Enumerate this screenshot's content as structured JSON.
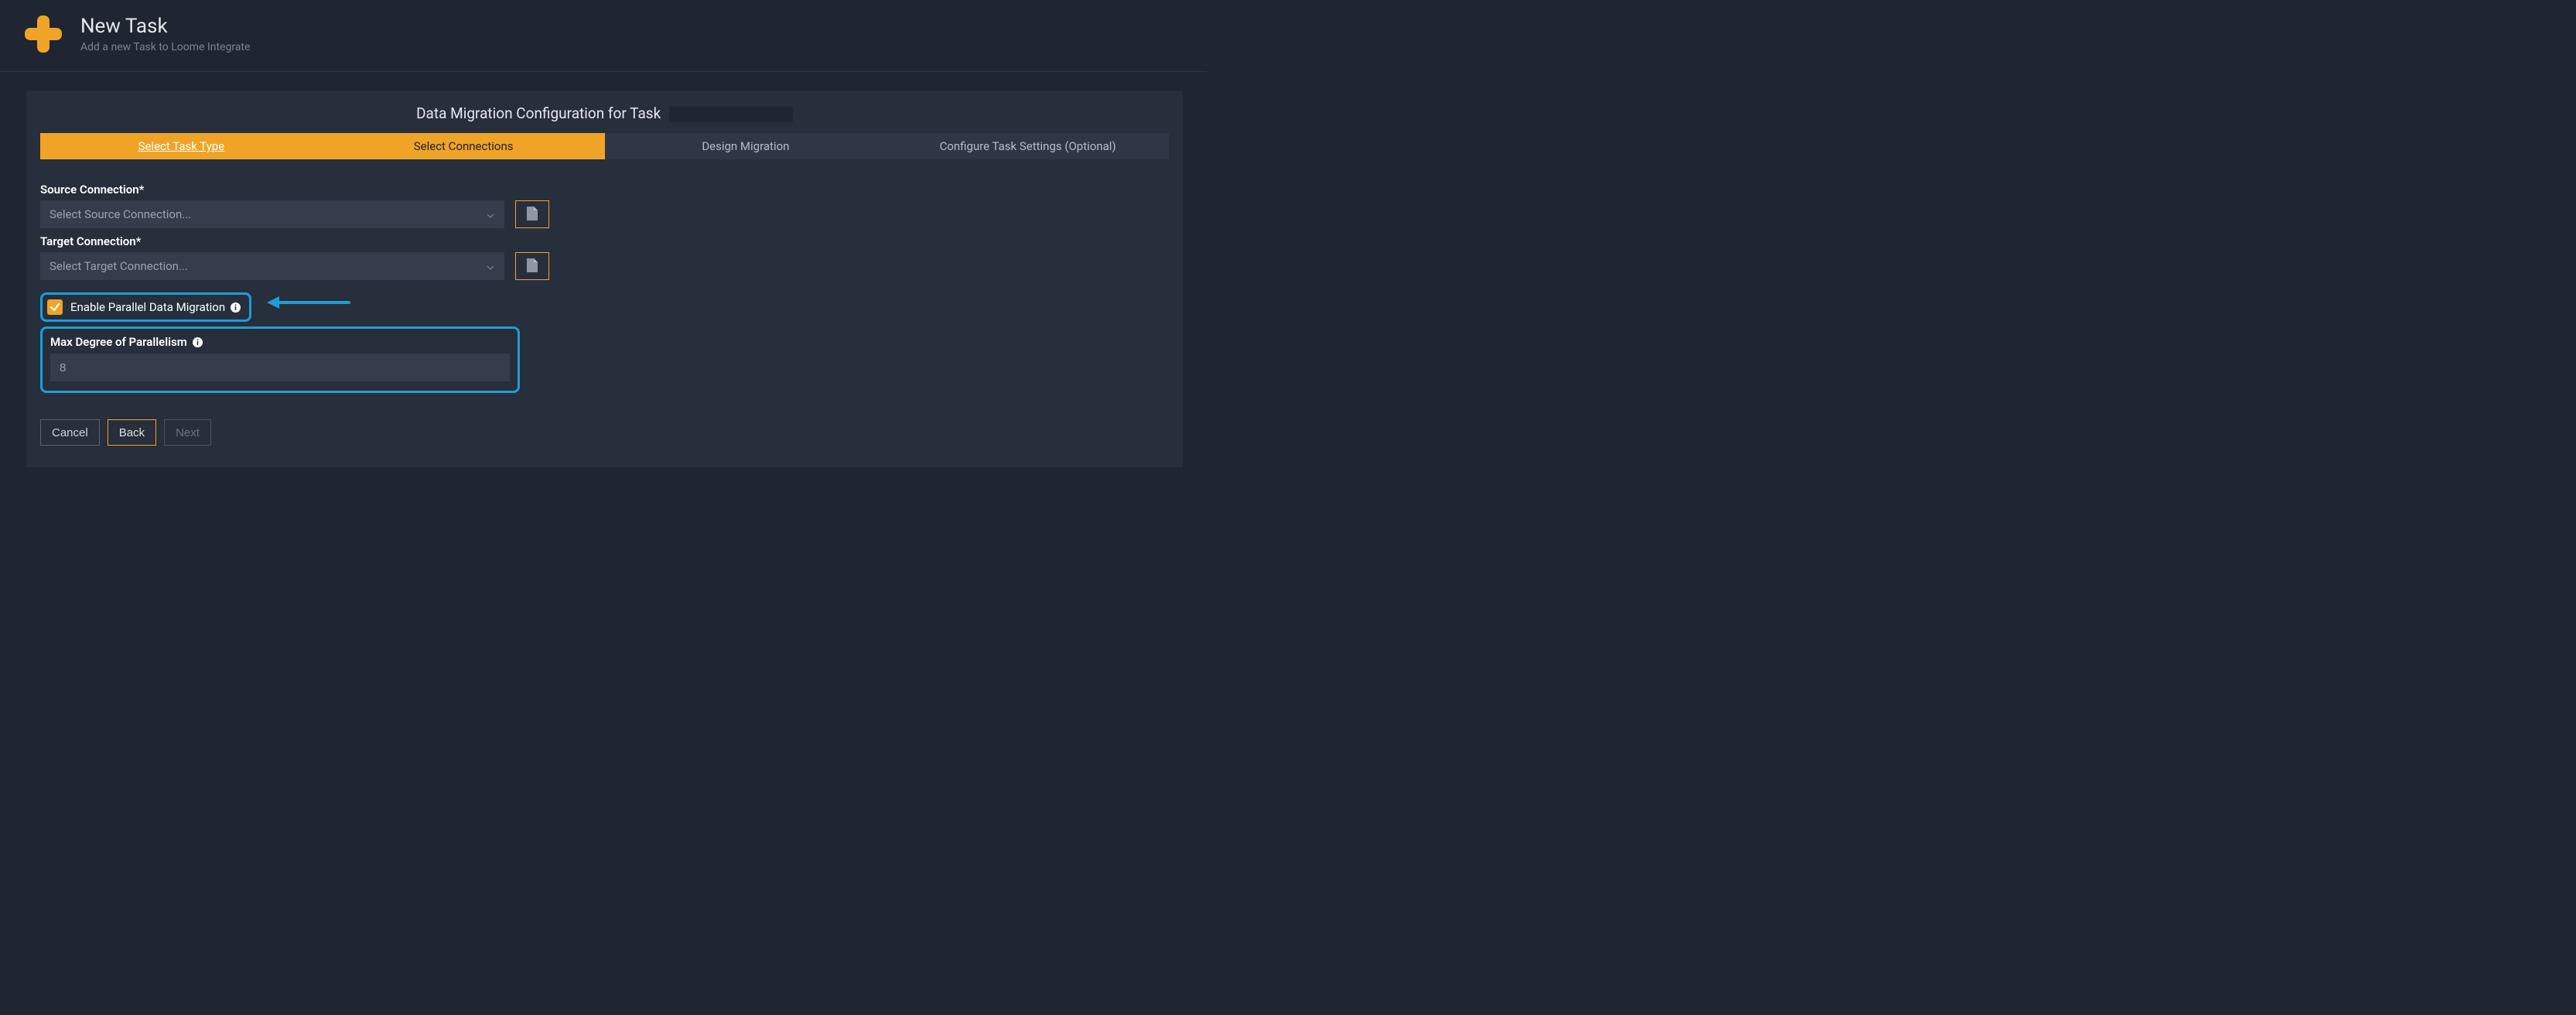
{
  "header": {
    "title": "New Task",
    "subtitle": "Add a new Task to Loome Integrate"
  },
  "panel": {
    "title": "Data Migration Configuration for Task"
  },
  "stepper": {
    "steps": [
      {
        "label": "Select Task Type"
      },
      {
        "label": "Select Connections"
      },
      {
        "label": "Design Migration"
      },
      {
        "label": "Configure Task Settings (Optional)"
      }
    ]
  },
  "form": {
    "source_label": "Source Connection*",
    "source_placeholder": "Select Source Connection...",
    "target_label": "Target Connection*",
    "target_placeholder": "Select Target Connection...",
    "parallel_label": "Enable Parallel Data Migration",
    "parallel_checked": true,
    "maxdop_label": "Max Degree of Parallelism",
    "maxdop_value": "8"
  },
  "buttons": {
    "cancel": "Cancel",
    "back": "Back",
    "next": "Next"
  },
  "colors": {
    "accent": "#f0a427",
    "highlight": "#1c9ed8"
  }
}
